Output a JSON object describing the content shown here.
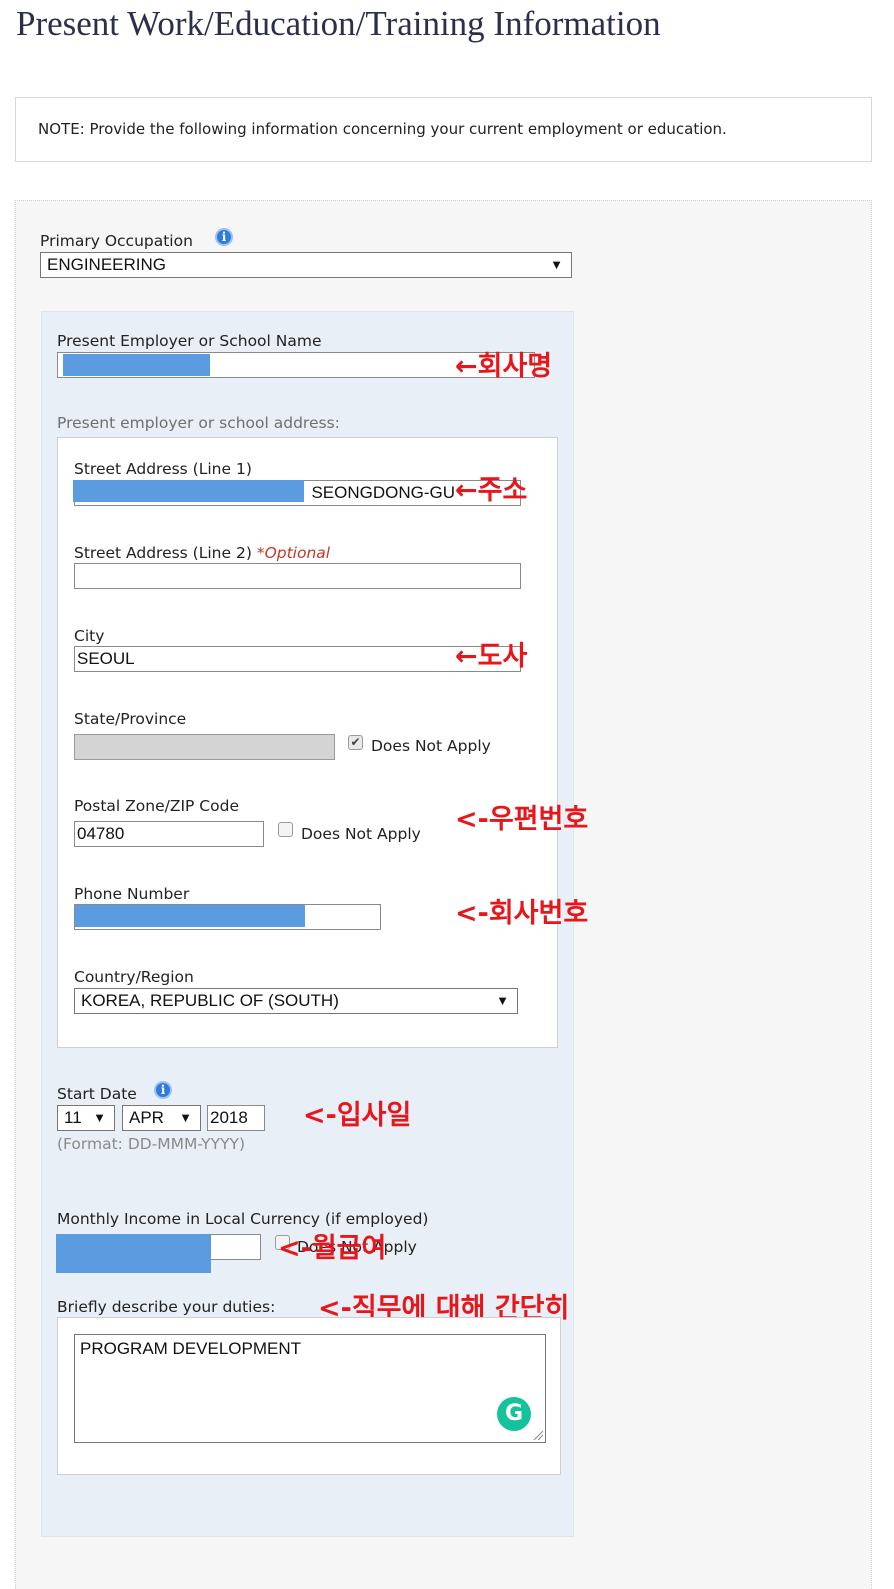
{
  "page_title": "Present Work/Education/Training Information",
  "note": "NOTE: Provide the following information concerning your current employment or education.",
  "primary_occupation": {
    "label": "Primary Occupation",
    "value": "ENGINEERING",
    "info_icon": "info-icon"
  },
  "employer": {
    "name_label": "Present Employer or School Name",
    "annotation": "←회사명"
  },
  "address": {
    "heading": "Present employer or school address:",
    "street1_label": "Street Address (Line 1)",
    "street1_visible_value": "SEONGDONG-GU",
    "street1_annotation": "←주소",
    "street2_label": "Street Address (Line 2)",
    "street2_optional": "*Optional",
    "street2_value": "",
    "city_label": "City",
    "city_value": "SEOUL",
    "city_annotation": "←도사",
    "state_label": "State/Province",
    "state_does_not_apply": "Does Not Apply",
    "state_does_not_apply_checked": true,
    "postal_label": "Postal Zone/ZIP Code",
    "postal_value": "04780",
    "postal_does_not_apply": "Does Not Apply",
    "postal_does_not_apply_checked": false,
    "postal_annotation": "<-우편번호",
    "phone_label": "Phone Number",
    "phone_annotation": "<-회사번호",
    "country_label": "Country/Region",
    "country_value": "KOREA, REPUBLIC OF (SOUTH)"
  },
  "start_date": {
    "label": "Start Date",
    "day": "11",
    "month": "APR",
    "year": "2018",
    "format_hint": "(Format: DD-MMM-YYYY)",
    "annotation": "<-입사일"
  },
  "income": {
    "label": "Monthly Income in Local Currency (if employed)",
    "does_not_apply": "Does Not Apply",
    "does_not_apply_checked": false,
    "annotation": "<-월급여"
  },
  "duties": {
    "label": "Briefly describe your duties:",
    "value": "PROGRAM DEVELOPMENT",
    "annotation": "<-직무에 대해 간단히"
  },
  "colors": {
    "annotation_red": "#e8151b",
    "redaction_blue": "#5b9bdf",
    "panel_blue": "#e9eff6",
    "title_navy": "#2b2f4a"
  }
}
